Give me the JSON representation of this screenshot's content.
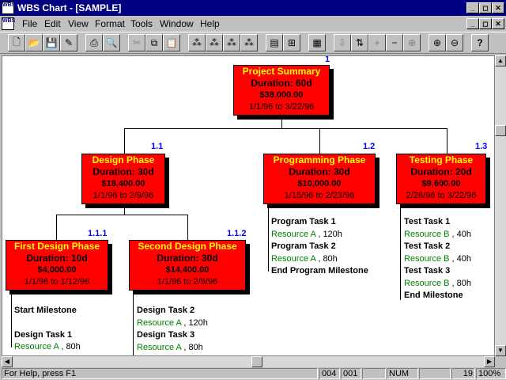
{
  "window": {
    "title": "WBS Chart - [SAMPLE]",
    "app_icon_text": "WBS"
  },
  "menu": [
    "File",
    "Edit",
    "View",
    "Format",
    "Tools",
    "Window",
    "Help"
  ],
  "toolbar": {
    "buttons": [
      "new-icon",
      "open-icon",
      "save-icon",
      "preview-icon",
      "print-icon",
      "print-preview-icon",
      "cut-icon",
      "copy-icon",
      "paste-icon",
      "layout-1-icon",
      "layout-2-icon",
      "layout-3-icon",
      "layout-4-icon",
      "view-icon",
      "org-icon",
      "calc-icon",
      "move-left-icon",
      "move-up-icon",
      "add-icon",
      "remove-icon",
      "expand-icon",
      "zoom-in-icon",
      "zoom-out-icon",
      "help-icon"
    ]
  },
  "nodes": {
    "root": {
      "id": "1",
      "title": "Project Summary",
      "duration": "Duration: 60d",
      "cost": "$38,000.00",
      "dates": "1/1/96 to 3/22/96"
    },
    "design": {
      "id": "1.1",
      "title": "Design Phase",
      "duration": "Duration: 30d",
      "cost": "$18,400.00",
      "dates": "1/1/96 to 2/9/96"
    },
    "programming": {
      "id": "1.2",
      "title": "Programming Phase",
      "duration": "Duration: 30d",
      "cost": "$10,000.00",
      "dates": "1/15/96 to 2/23/96"
    },
    "testing": {
      "id": "1.3",
      "title": "Testing Phase",
      "duration": "Duration: 20d",
      "cost": "$9,600.00",
      "dates": "2/26/96 to 3/22/96"
    },
    "first_design": {
      "id": "1.1.1",
      "title": "First Design Phase",
      "duration": "Duration: 10d",
      "cost": "$4,000.00",
      "dates": "1/1/96 to 1/12/96"
    },
    "second_design": {
      "id": "1.1.2",
      "title": "Second Design Phase",
      "duration": "Duration: 30d",
      "cost": "$14,400.00",
      "dates": "1/1/96 to 2/9/96"
    }
  },
  "tasks": {
    "programming": [
      {
        "type": "task",
        "text": "Program Task 1"
      },
      {
        "type": "res",
        "name": "Resource A",
        "hours": ", 120h"
      },
      {
        "type": "task",
        "text": "Program Task 2"
      },
      {
        "type": "res",
        "name": "Resource A",
        "hours": ", 80h"
      },
      {
        "type": "task",
        "text": "End Program Milestone"
      }
    ],
    "testing": [
      {
        "type": "task",
        "text": "Test Task 1"
      },
      {
        "type": "res",
        "name": "Resource B",
        "hours": ", 40h"
      },
      {
        "type": "task",
        "text": "Test Task 2"
      },
      {
        "type": "res",
        "name": "Resource B",
        "hours": ", 40h"
      },
      {
        "type": "task",
        "text": "Test Task 3"
      },
      {
        "type": "res",
        "name": "Resource B",
        "hours": ", 80h"
      },
      {
        "type": "task",
        "text": "End Milestone"
      }
    ],
    "first_design": [
      {
        "type": "task",
        "text": "Start Milestone"
      },
      {
        "type": "gap"
      },
      {
        "type": "task",
        "text": "Design Task 1"
      },
      {
        "type": "res",
        "name": "Resource A",
        "hours": ", 80h"
      }
    ],
    "second_design": [
      {
        "type": "task",
        "text": "Design Task 2"
      },
      {
        "type": "res",
        "name": "Resource A",
        "hours": ", 120h"
      },
      {
        "type": "task",
        "text": "Design Task 3"
      },
      {
        "type": "res",
        "name": "Resource A",
        "hours": ", 80h"
      }
    ]
  },
  "status": {
    "help": "For Help, press F1",
    "row": "004",
    "col": "001",
    "num": "NUM",
    "count": "19",
    "zoom": "100%"
  },
  "colors": {
    "node_fill": "#ff0000",
    "node_title": "#ffff00",
    "wbs_id": "#0000ff",
    "resource": "#008000",
    "titlebar": "#000080"
  }
}
